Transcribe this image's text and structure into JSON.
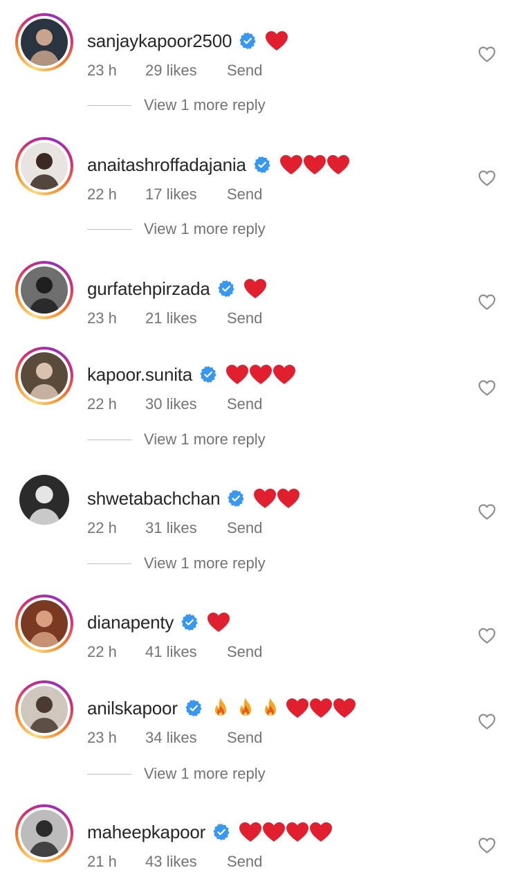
{
  "comments": [
    {
      "username": "sanjaykapoor2500",
      "time": "23 h",
      "likes": "29 likes",
      "send": "Send",
      "view_more": "View 1 more reply",
      "reactions": [
        "heart"
      ],
      "story_ring": true
    },
    {
      "username": "anaitashroffadajania",
      "time": "22 h",
      "likes": "17 likes",
      "send": "Send",
      "view_more": "View 1 more reply",
      "reactions": [
        "heart",
        "heart",
        "heart"
      ],
      "story_ring": true
    },
    {
      "username": "gurfatehpirzada",
      "time": "23 h",
      "likes": "21 likes",
      "send": "Send",
      "view_more": "",
      "reactions": [
        "heart"
      ],
      "story_ring": true
    },
    {
      "username": "kapoor.sunita",
      "time": "22 h",
      "likes": "30 likes",
      "send": "Send",
      "view_more": "View 1 more reply",
      "reactions": [
        "heart",
        "heart",
        "heart"
      ],
      "story_ring": true
    },
    {
      "username": "shwetabachchan",
      "time": "22 h",
      "likes": "31 likes",
      "send": "Send",
      "view_more": "View 1 more reply",
      "reactions": [
        "heart",
        "heart"
      ],
      "story_ring": false
    },
    {
      "username": "dianapenty",
      "time": "22 h",
      "likes": "41 likes",
      "send": "Send",
      "view_more": "",
      "reactions": [
        "heart"
      ],
      "story_ring": true
    },
    {
      "username": "anilskapoor",
      "time": "23 h",
      "likes": "34 likes",
      "send": "Send",
      "view_more": "View 1 more reply",
      "reactions": [
        "fire",
        "fire",
        "fire",
        "heart",
        "heart",
        "heart"
      ],
      "story_ring": true
    },
    {
      "username": "maheepkapoor",
      "time": "21 h",
      "likes": "43 likes",
      "send": "Send",
      "view_more": "",
      "reactions": [
        "heart",
        "heart",
        "heart",
        "heart"
      ],
      "story_ring": true
    }
  ],
  "icons": {
    "verified": "verified-badge-icon",
    "like": "heart-outline-icon",
    "heart_emoji": "red-heart-emoji",
    "fire_emoji": "fire-emoji"
  },
  "colors": {
    "verified_blue": "#3897f0",
    "heart_red": "#e0202e",
    "meta_gray": "#737373",
    "text": "#262626"
  }
}
